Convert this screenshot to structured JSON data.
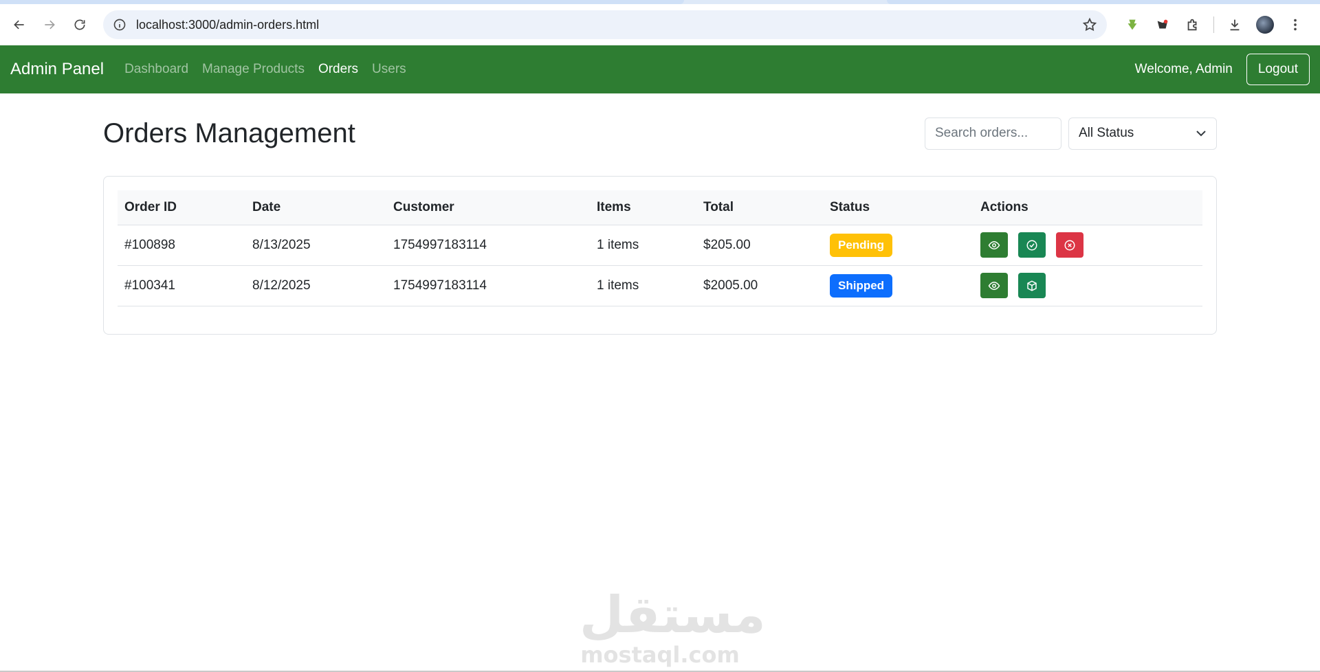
{
  "browser": {
    "url": "localhost:3000/admin-orders.html"
  },
  "navbar": {
    "brand": "Admin Panel",
    "links": [
      {
        "label": "Dashboard",
        "active": false
      },
      {
        "label": "Manage Products",
        "active": false
      },
      {
        "label": "Orders",
        "active": true
      },
      {
        "label": "Users",
        "active": false
      }
    ],
    "welcome": "Welcome, Admin",
    "logout_label": "Logout",
    "color": "#2e7d32"
  },
  "page": {
    "title": "Orders Management",
    "search_placeholder": "Search orders...",
    "status_filter": "All Status"
  },
  "table": {
    "headers": [
      "Order ID",
      "Date",
      "Customer",
      "Items",
      "Total",
      "Status",
      "Actions"
    ],
    "rows": [
      {
        "id": "#100898",
        "date": "8/13/2025",
        "customer": "1754997183114",
        "items": "1 items",
        "total": "$205.00",
        "status": "Pending",
        "status_color": "#ffc107",
        "actions": [
          "eye-icon",
          "check-circle-icon",
          "x-circle-icon"
        ]
      },
      {
        "id": "#100341",
        "date": "8/12/2025",
        "customer": "1754997183114",
        "items": "1 items",
        "total": "$2005.00",
        "status": "Shipped",
        "status_color": "#0d6efd",
        "actions": [
          "eye-icon",
          "box-icon"
        ]
      }
    ]
  },
  "watermark": {
    "arabic": "مستقل",
    "latin": "mostaql.com"
  }
}
